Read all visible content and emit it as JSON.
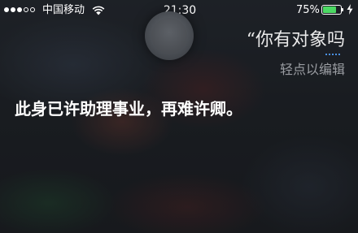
{
  "status_bar": {
    "signal": {
      "filled": 3,
      "total": 5
    },
    "carrier": "中国移动",
    "wifi_icon": "wifi-icon",
    "time": "21:30",
    "battery_percent_label": "75%",
    "battery_level": 0.75,
    "charging_icon": "charging-bolt-icon",
    "colors": {
      "battery": "#4cd964"
    }
  },
  "siri": {
    "orb_icon": "siri-orb-icon",
    "query": {
      "open_quote": "“",
      "text": "你有对象吗"
    },
    "tap_to_edit": "轻点以编辑",
    "response": "此身已许助理事业，再难许卿。"
  }
}
